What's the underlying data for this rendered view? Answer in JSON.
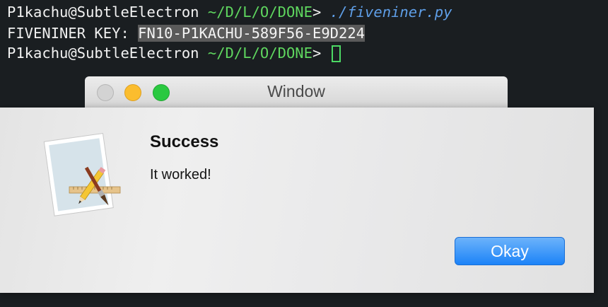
{
  "terminal": {
    "line1": {
      "user": "P1kachu@SubtleElectron",
      "path": " ~/D/L/O/DONE",
      "prompt": "> ",
      "command": "./fiveniner.py"
    },
    "line2": {
      "label": "FIVENINER KEY: ",
      "key": "FN10-P1KACHU-589F56-E9D224"
    },
    "line3": {
      "user": "P1kachu@SubtleElectron",
      "path": " ~/D/L/O/DONE",
      "prompt": "> "
    }
  },
  "window": {
    "title": "Window"
  },
  "alert": {
    "title": "Success",
    "message": "It worked!",
    "button_label": "Okay",
    "icon": "script-editor-app-icon"
  },
  "colors": {
    "terminal_bg": "#1a1e21",
    "path_green": "#5fd75f",
    "command_blue": "#5f9fe8",
    "button_blue": "#1c83f8"
  }
}
